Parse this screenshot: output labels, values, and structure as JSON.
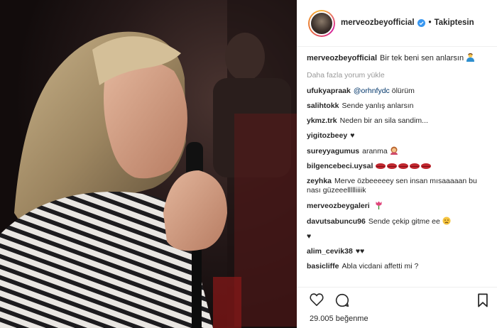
{
  "post": {
    "username": "merveozbeyofficial",
    "follow_label": "Takiptesin",
    "separator": "•",
    "caption_user": "merveozbeyofficial",
    "caption_text": "Bir tek beni sen anlarsın",
    "load_more": "Daha fazla yorum yükle",
    "likes_count": "29.005",
    "likes_label": "beğenme"
  },
  "comments": [
    {
      "user": "ufukyapraak",
      "mention": "@orhnfydc",
      "text": "ölürüm"
    },
    {
      "user": "salihtokk",
      "text": "Sende yanlış anlarsın"
    },
    {
      "user": "ykmz.trk",
      "text": "Neden bir an sila sandim..."
    },
    {
      "user": "yigitozbeey",
      "text": "♥"
    },
    {
      "user": "sureyyagumus",
      "text": "aranma"
    },
    {
      "user": "bilgencebeci.uysal",
      "text": ""
    },
    {
      "user": "zeyhka",
      "text": "Merve özbeeeeey sen insan mısaaaaan bu nası güzeeellllliiiik"
    },
    {
      "user": "merveozbeygaleri",
      "text": ""
    },
    {
      "user": "davutsabuncu96",
      "text": "Sende çekip gitme ee"
    },
    {
      "user": "",
      "text": "♥"
    },
    {
      "user": "alim_cevik38",
      "text": "♥♥"
    },
    {
      "user": "basicliffe",
      "text": "Abla vicdani affetti mi ?"
    }
  ],
  "icons": {
    "verified_color": "#3897f0",
    "lips_color": "#c0262e"
  }
}
